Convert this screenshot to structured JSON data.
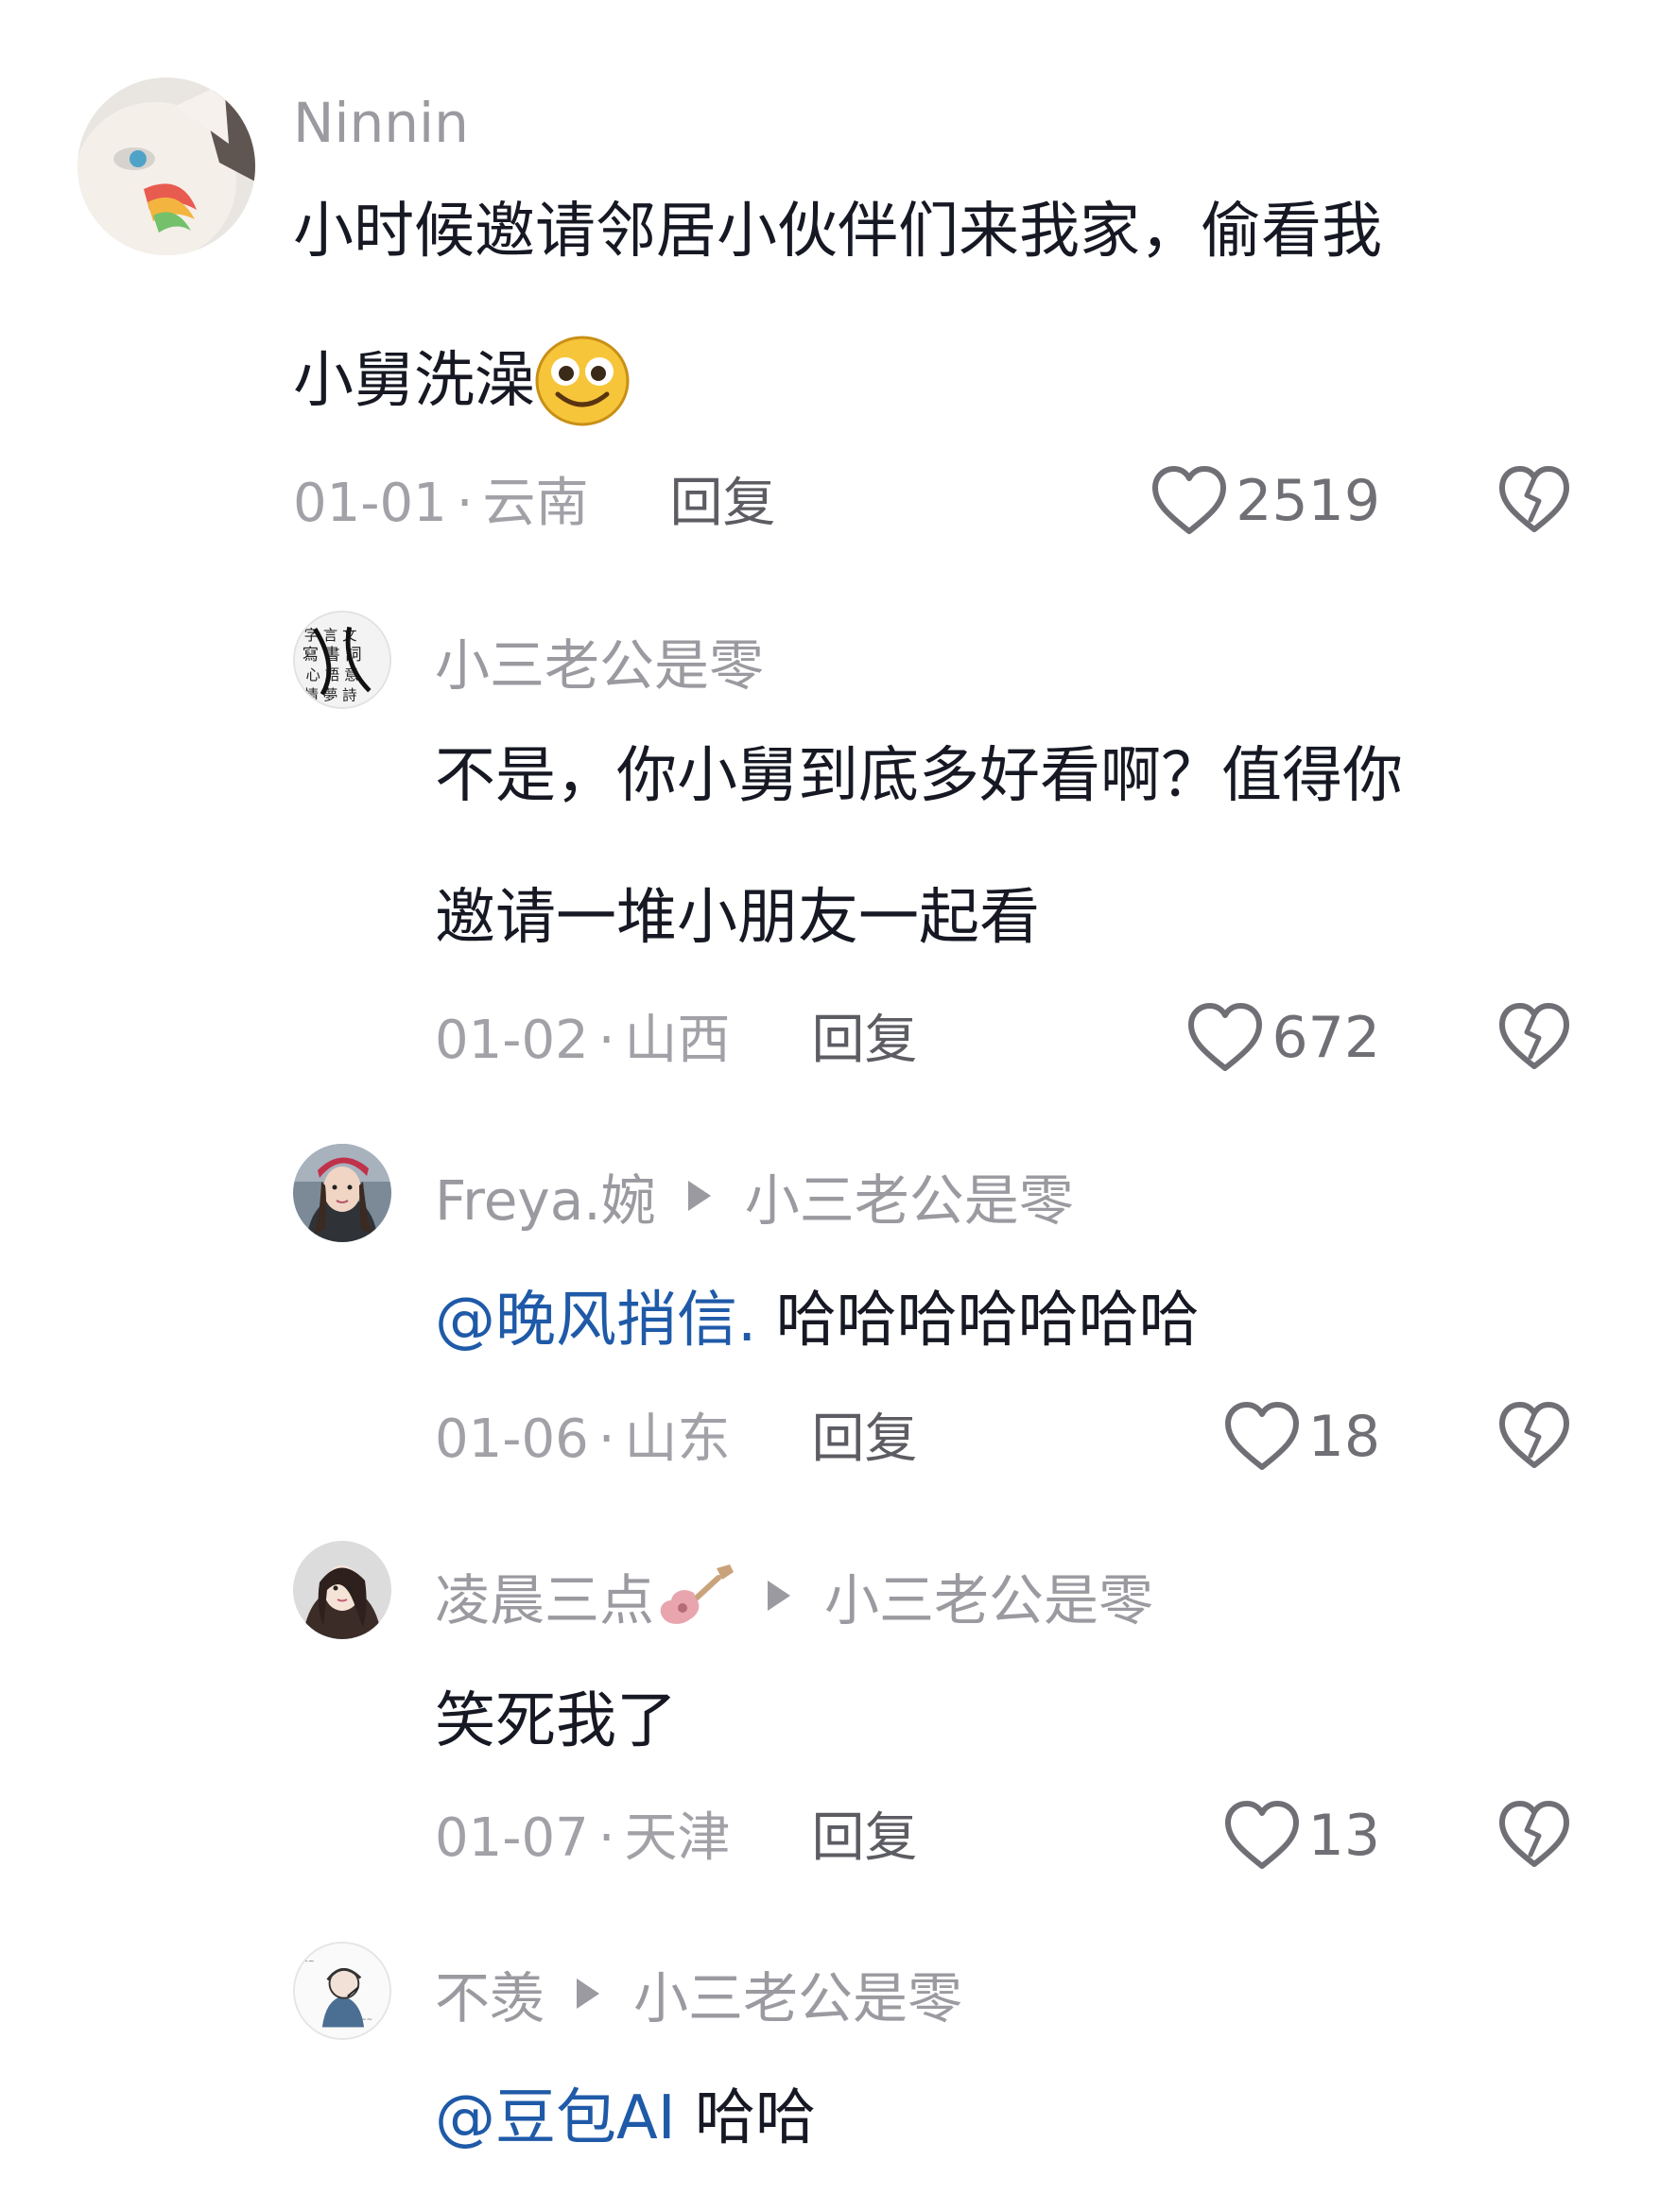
{
  "comments": [
    {
      "author": "Ninnin",
      "reply_to": "",
      "text": "小时候邀请邻居小伙伴们来我家，偷看我",
      "text_line2": "小舅洗澡",
      "date": "01-01",
      "region": "云南",
      "reply_label": "回复",
      "likes": "2519",
      "avatar_icon": "cat-avatar-icon",
      "emoji": "slightly-smiling-face-emoji"
    },
    {
      "author": "小三老公是零",
      "reply_to": "",
      "text": "不是，你小舅到底多好看啊？值得你",
      "text_line2": "邀请一堆小朋友一起看",
      "date": "01-02",
      "region": "山西",
      "reply_label": "回复",
      "likes": "672",
      "avatar_icon": "calligraphy-avatar-icon"
    },
    {
      "author": "Freya.婉",
      "reply_to": "小三老公是零",
      "mention": "@晚风捎信.",
      "text": " 哈哈哈哈哈哈哈",
      "date": "01-06",
      "region": "山东",
      "reply_label": "回复",
      "likes": "18",
      "avatar_icon": "girl-avatar-icon"
    },
    {
      "author": "凌晨三点",
      "author_emoji": "guitar-emoji",
      "reply_to": "小三老公是零",
      "text": "笑死我了",
      "date": "01-07",
      "region": "天津",
      "reply_label": "回复",
      "likes": "13",
      "avatar_icon": "girl2-avatar-icon"
    },
    {
      "author": "不羡",
      "reply_to": "小三老公是零",
      "mention": "@豆包AI",
      "text": " 哈哈",
      "avatar_icon": "sketch-avatar-icon"
    }
  ],
  "meta_separator": "·",
  "colors": {
    "text": "#161823",
    "meta": "#a1a1a7",
    "mention": "#1f5aa8",
    "icon": "#6f6f75"
  }
}
